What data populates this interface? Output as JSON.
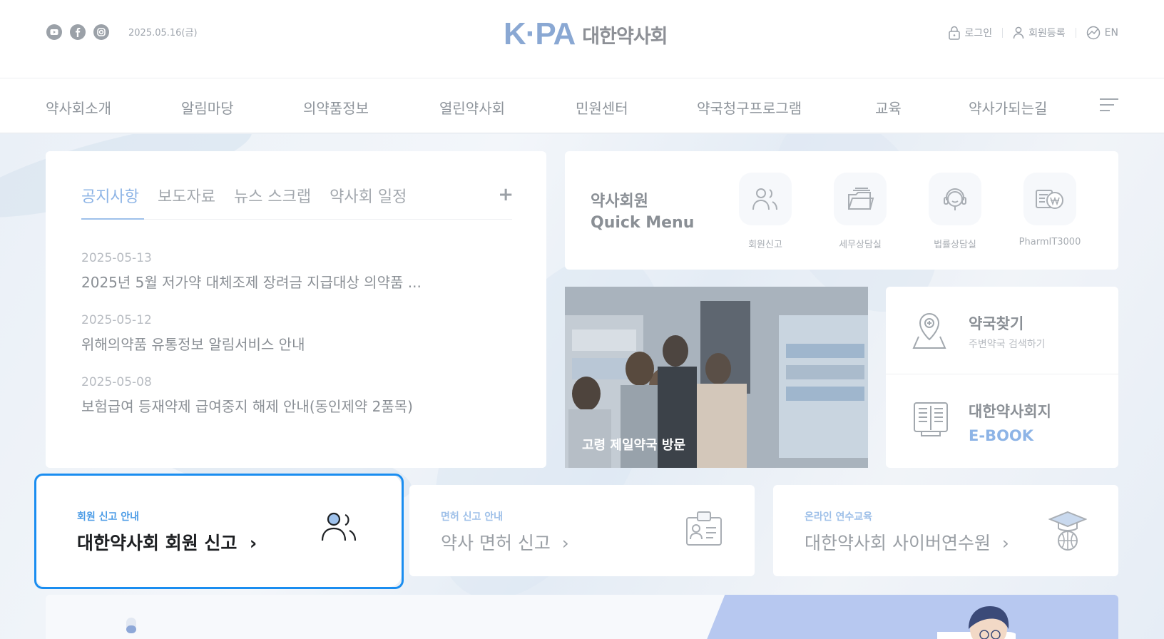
{
  "header": {
    "date": "2025.05.16(금)",
    "logo_mark": "K·PA",
    "logo_text": "대한약사회",
    "social": [
      "youtube-icon",
      "facebook-icon",
      "instagram-icon"
    ],
    "util": {
      "login": "로그인",
      "register": "회원등록",
      "lang": "EN"
    }
  },
  "nav": {
    "items": [
      "약사회소개",
      "알림마당",
      "의약품정보",
      "열린약사회",
      "민원센터",
      "약국청구프로그램",
      "교육",
      "약사가되는길"
    ]
  },
  "notice": {
    "tabs": [
      "공지사항",
      "보도자료",
      "뉴스 스크랩",
      "약사회 일정"
    ],
    "more": "+",
    "items": [
      {
        "date": "2025-05-13",
        "title": "2025년 5월 저가약 대체조제 장려금 지급대상 의약품 ..."
      },
      {
        "date": "2025-05-12",
        "title": "위해의약품 유통정보 알림서비스 안내"
      },
      {
        "date": "2025-05-08",
        "title": "보험급여 등재약제 급여중지 해제 안내(동인제약 2품목)"
      }
    ]
  },
  "quick": {
    "title_line1": "약사회원",
    "title_line2": "Quick Menu",
    "items": [
      "회원신고",
      "세무상담실",
      "법률상담실",
      "PharmIT3000"
    ]
  },
  "photo": {
    "caption": "고령 제일약국 방문"
  },
  "side": {
    "find_title": "약국찾기",
    "find_sub": "주변약국 검색하기",
    "journal_title": "대한약사회지",
    "journal_sub": "E-BOOK"
  },
  "cards": [
    {
      "small": "회원 신고 안내",
      "title": "대한약사회 회원 신고"
    },
    {
      "small": "면허 신고 안내",
      "title": "약사 면허 신고"
    },
    {
      "small": "온라인 연수교육",
      "title": "대한약사회 사이버연수원"
    }
  ],
  "colors": {
    "accent": "#1a8df0",
    "tab_active": "#8db4e6",
    "logo": "#8aa8d3"
  }
}
